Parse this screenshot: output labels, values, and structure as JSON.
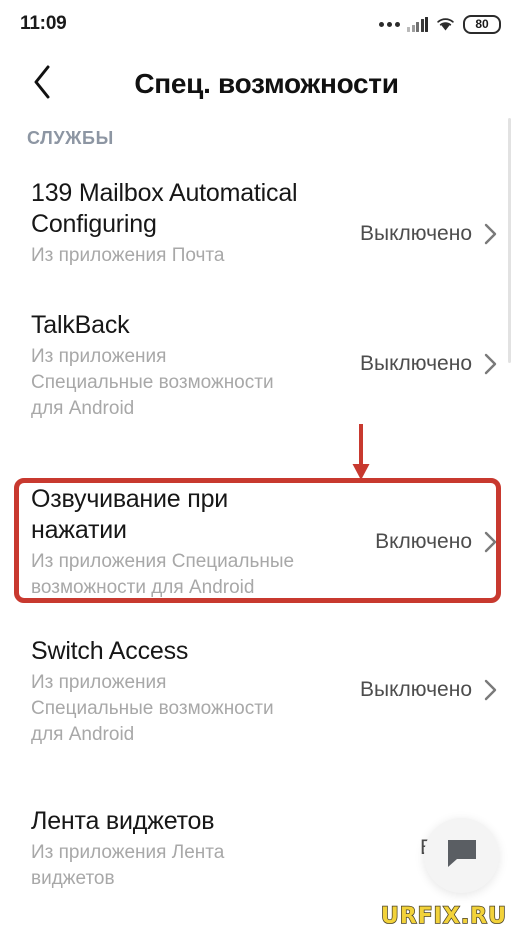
{
  "statusbar": {
    "time": "11:09",
    "battery_level": "80",
    "icons": [
      "more-dots-icon",
      "cellular-signal-icon",
      "wifi-icon",
      "battery-icon"
    ]
  },
  "header": {
    "back_icon": "chevron-left-icon",
    "title": "Спец. возможности"
  },
  "section": {
    "label": "СЛУЖБЫ"
  },
  "list": {
    "items": [
      {
        "title": "139 Mailbox Automatical\nConfiguring",
        "subtitle": "Из приложения Почта",
        "status": "Выключено",
        "chevron": "chevron-right-icon",
        "highlighted": false
      },
      {
        "title": "TalkBack",
        "subtitle": "Из приложения\nСпециальные возможности\nдля Android",
        "status": "Выключено",
        "chevron": "chevron-right-icon",
        "highlighted": false
      },
      {
        "title": "Озвучивание при\nнажатии",
        "subtitle": "Из приложения Специальные\nвозможности для Android",
        "status": "Включено",
        "chevron": "chevron-right-icon",
        "highlighted": true
      },
      {
        "title": "Switch Access",
        "subtitle": "Из приложения\nСпециальные возможности\nдля Android",
        "status": "Выключено",
        "chevron": "chevron-right-icon",
        "highlighted": false
      },
      {
        "title": "Лента виджетов",
        "subtitle": "Из приложения Лента\nвиджетов",
        "status": "Выключ",
        "chevron": "chevron-right-icon",
        "highlighted": false
      }
    ]
  },
  "annotation": {
    "highlight_color": "#c8392f",
    "arrow_color": "#c8392f",
    "arrow_icon": "down-arrow-icon"
  },
  "fab": {
    "icon": "chat-bubble-icon"
  },
  "watermark": {
    "text": "URFIX.RU",
    "color": "#f2d23a"
  }
}
